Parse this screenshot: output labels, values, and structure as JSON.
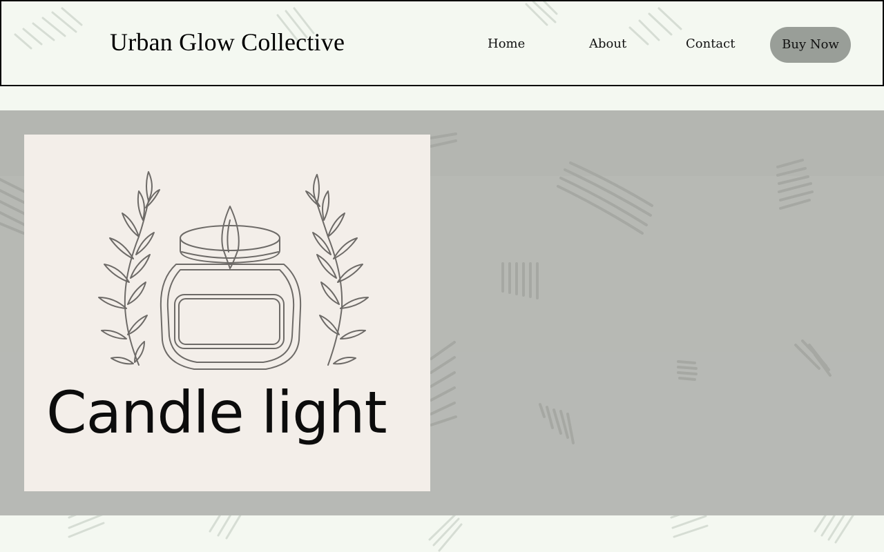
{
  "header": {
    "brand": "Urban Glow Collective",
    "nav": {
      "home": "Home",
      "about": "About",
      "contact": "Contact"
    },
    "cta": "Buy Now"
  },
  "hero": {
    "logo": {
      "wordmark": "Candle light",
      "icon": "candle-jar-icon",
      "decor": "laurel-branch-icon"
    }
  },
  "colors": {
    "page_bg": "#f4f8f1",
    "hero_bg": "#b7b9b4",
    "logo_bg": "#f3eee9",
    "button_bg": "#999e98",
    "border": "#000000"
  }
}
